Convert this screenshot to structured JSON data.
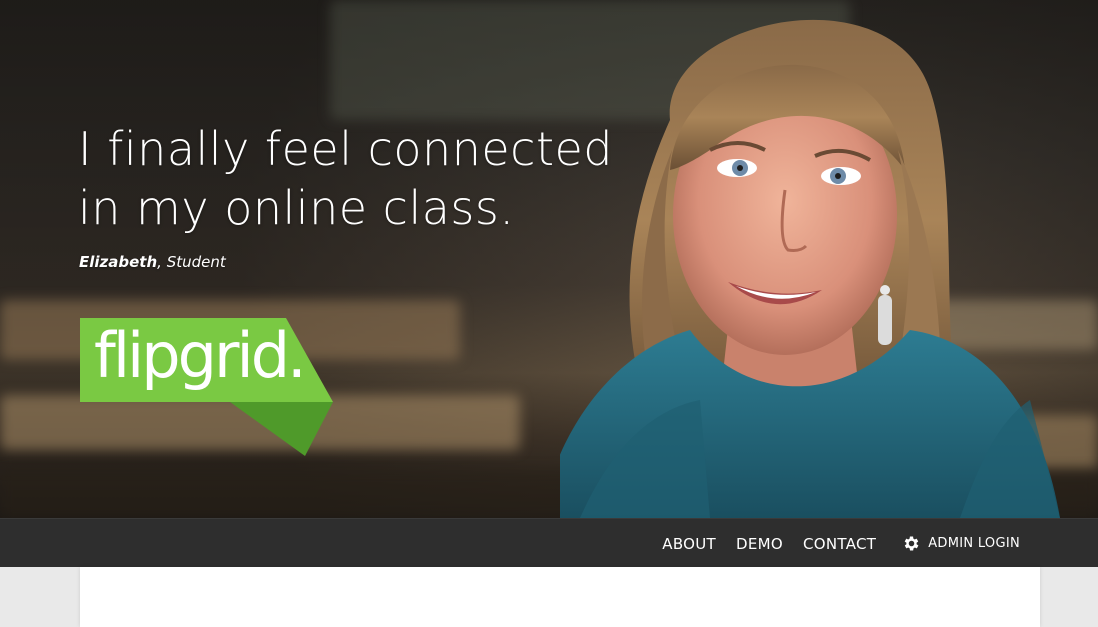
{
  "hero": {
    "quote_line1": "I finally feel connected",
    "quote_line2": "in my online class.",
    "attribution_name": "Elizabeth",
    "attribution_role": ", Student",
    "logo_text": "flipgrid."
  },
  "colors": {
    "brand_green": "#7ac943",
    "brand_green_dark": "#4f9a2a",
    "navbar_bg": "#2e2e2e"
  },
  "nav": {
    "items": [
      {
        "label": "ABOUT"
      },
      {
        "label": "DEMO"
      },
      {
        "label": "CONTACT"
      }
    ],
    "admin_label": "ADMIN LOGIN",
    "admin_icon": "gear-icon"
  }
}
